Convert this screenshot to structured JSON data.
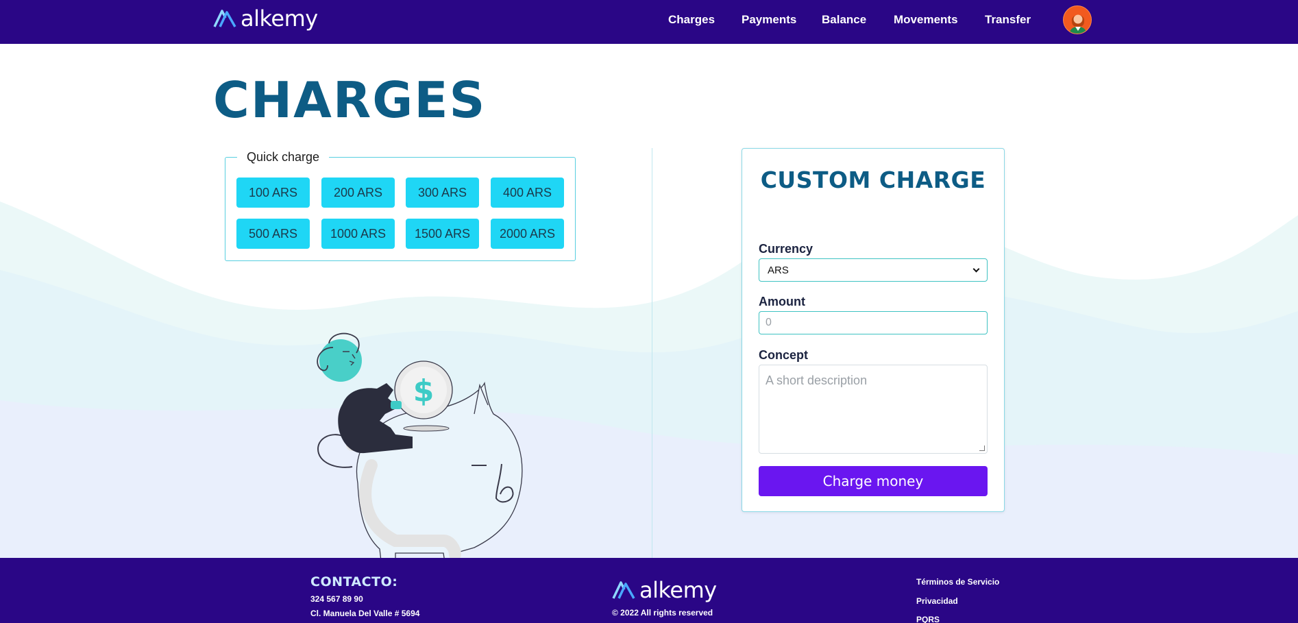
{
  "navbar": {
    "logo_text": "alkemy",
    "links": [
      "Charges",
      "Payments",
      "Balance",
      "Movements",
      "Transfer"
    ]
  },
  "page": {
    "title": "CHARGES"
  },
  "quick_charge": {
    "legend": "Quick charge",
    "buttons": [
      "100 ARS",
      "200 ARS",
      "300 ARS",
      "400 ARS",
      "500 ARS",
      "1000 ARS",
      "1500 ARS",
      "2000 ARS"
    ]
  },
  "custom_charge": {
    "title": "CUSTOM CHARGE",
    "currency_label": "Currency",
    "currency_value": "ARS",
    "amount_label": "Amount",
    "amount_placeholder": "0",
    "concept_label": "Concept",
    "concept_placeholder": "A short description",
    "submit_label": "Charge money"
  },
  "footer": {
    "contact_title": "CONTACTO:",
    "phone": "324 567 89 90",
    "address": "Cl. Manuela Del Valle # 5694",
    "logo_text": "alkemy",
    "copyright": "© 2022 All rights reserved",
    "links": [
      "Términos de Servicio",
      "Privacidad",
      "PQRS"
    ]
  },
  "colors": {
    "navbar_bg": "#2a0686",
    "title_color": "#0d5c85",
    "quick_button_bg": "#1fd6f5",
    "submit_button_bg": "#6a16f0",
    "input_border": "#3ec2c2"
  },
  "icons": {
    "logo": "alkemy-logo-icon",
    "avatar": "user-avatar-icon",
    "illustration": "piggy-bank-illustration",
    "dropdown": "chevron-down-icon"
  }
}
